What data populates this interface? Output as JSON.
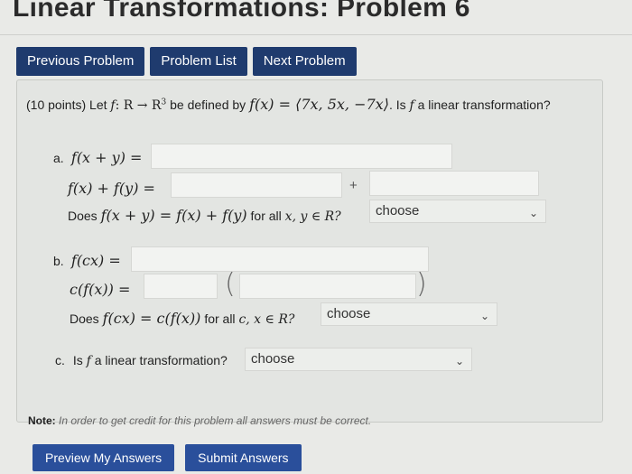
{
  "page": {
    "title": "Linear Transformations: Problem 6"
  },
  "nav": {
    "prev_label": "Previous Problem",
    "list_label": "Problem List",
    "next_label": "Next Problem"
  },
  "problem": {
    "points": "(10 points)",
    "let": "Let",
    "f": "f",
    "colon_map": ": R → R",
    "sup3": "3",
    "defined": "be defined by",
    "def_expr": "f(x) = ⟨7x, 5x, −7x⟩",
    "question": ". Is",
    "question_end": "a linear transformation?"
  },
  "part_a": {
    "letter": "a.",
    "line1": "f(x + y) =",
    "line2": "f(x) + f(y) =",
    "plus": "+",
    "does": "Does",
    "does_expr": "f(x + y) = f(x) + f(y)",
    "for_all": "for all",
    "for_all_expr": "x, y ∈ R?",
    "select_value": "choose"
  },
  "part_b": {
    "letter": "b.",
    "line1": "f(cx) =",
    "line2": "c(f(x)) =",
    "paren_open": "(",
    "paren_close": ")",
    "does": "Does",
    "does_expr": "f(cx) = c(f(x))",
    "for_all": "for all",
    "for_all_expr": "c, x ∈ R?",
    "select_value": "choose"
  },
  "part_c": {
    "letter": "c.",
    "question": "Is",
    "f": "f",
    "question_end": "a linear transformation?",
    "select_value": "choose"
  },
  "note": {
    "label": "Note:",
    "text": "In order to get credit for this problem all answers must be correct."
  },
  "actions": {
    "preview_label": "Preview My Answers",
    "submit_label": "Submit Answers"
  }
}
